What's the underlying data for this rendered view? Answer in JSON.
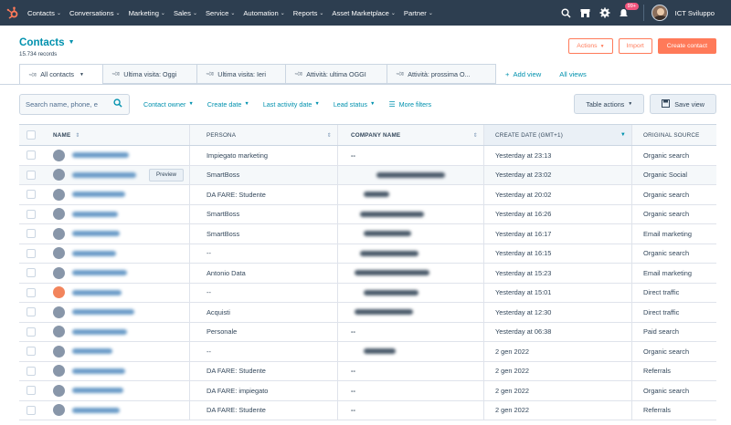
{
  "nav": {
    "items": [
      "Contacts",
      "Conversations",
      "Marketing",
      "Sales",
      "Service",
      "Automation",
      "Reports",
      "Asset Marketplace",
      "Partner"
    ],
    "notification_count": "99+",
    "account_name": "ICT Sviluppo"
  },
  "header": {
    "title": "Contacts",
    "record_count": "15.734 records",
    "actions_label": "Actions",
    "import_label": "Import",
    "create_label": "Create contact"
  },
  "tabs": {
    "items": [
      "All contacts",
      "Ultima visita: Oggi",
      "Ultima visita: Ieri",
      "Attività: ultima OGGI",
      "Attività: prossima O..."
    ],
    "add_view": "Add view",
    "all_views": "All views"
  },
  "filters": {
    "search_placeholder": "Search name, phone, e",
    "contact_owner": "Contact owner",
    "create_date": "Create date",
    "last_activity_date": "Last activity date",
    "lead_status": "Lead status",
    "more_filters": "More filters",
    "table_actions": "Table actions",
    "save_view": "Save view"
  },
  "table": {
    "headers": [
      "NAME",
      "PERSONA",
      "COMPANY NAME",
      "CREATE DATE (GMT+1)",
      "ORIGINAL SOURCE"
    ],
    "preview_label": "Preview",
    "rows": [
      {
        "persona": "Impiegato marketing",
        "company": "--",
        "date": "Yesterday at 23:13",
        "source": "Organic search"
      },
      {
        "persona": "SmartBoss",
        "company": "",
        "date": "Yesterday at 23:02",
        "source": "Organic Social"
      },
      {
        "persona": "DA FARE: Studente",
        "company": "",
        "date": "Yesterday at 20:02",
        "source": "Organic search"
      },
      {
        "persona": "SmartBoss",
        "company": "",
        "date": "Yesterday at 16:26",
        "source": "Organic search"
      },
      {
        "persona": "SmartBoss",
        "company": "",
        "date": "Yesterday at 16:17",
        "source": "Email marketing"
      },
      {
        "persona": "--",
        "company": "",
        "date": "Yesterday at 16:15",
        "source": "Organic search"
      },
      {
        "persona": "Antonio Data",
        "company": "",
        "date": "Yesterday at 15:23",
        "source": "Email marketing"
      },
      {
        "persona": "--",
        "company": "",
        "date": "Yesterday at 15:01",
        "source": "Direct traffic"
      },
      {
        "persona": "Acquisti",
        "company": "",
        "date": "Yesterday at 12:30",
        "source": "Direct traffic"
      },
      {
        "persona": "Personale",
        "company": "--",
        "date": "Yesterday at 06:38",
        "source": "Paid search"
      },
      {
        "persona": "--",
        "company": "",
        "date": "2 gen 2022",
        "source": "Organic search"
      },
      {
        "persona": "DA FARE: Studente",
        "company": "--",
        "date": "2 gen 2022",
        "source": "Referrals"
      },
      {
        "persona": "DA FARE: impiegato",
        "company": "--",
        "date": "2 gen 2022",
        "source": "Organic search"
      },
      {
        "persona": "DA FARE: Studente",
        "company": "--",
        "date": "2 gen 2022",
        "source": "Referrals"
      }
    ]
  },
  "colors": {
    "nav_bg": "#2d3e50",
    "accent": "#ff7a59",
    "link": "#0091ae",
    "badge": "#f2547d"
  }
}
